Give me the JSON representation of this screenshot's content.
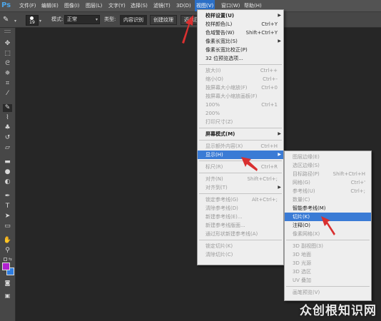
{
  "app": {
    "logo": "Ps"
  },
  "menubar": {
    "items": [
      "文件(F)",
      "编辑(E)",
      "图像(I)",
      "图层(L)",
      "文字(Y)",
      "选择(S)",
      "滤镜(T)",
      "3D(D)",
      "视图(V)",
      "窗口(W)",
      "帮助(H)"
    ],
    "active_index": 8
  },
  "options_bar": {
    "brush_size": "19",
    "mode_label": "模式:",
    "mode_value": "正常",
    "type_label": "类型:",
    "type_buttons": [
      "内容识别",
      "创建纹理",
      "近似匹配"
    ],
    "selected_type_index": 0
  },
  "colors": {
    "foreground": "#b020d0",
    "background": "#2f7de0",
    "menu_highlight": "#3a7bd5",
    "arrow": "#d93030"
  },
  "view_menu": {
    "items": [
      {
        "label": "校样设置(U)",
        "shortcut": "",
        "submenu": true,
        "bold": true,
        "disabled": false
      },
      {
        "label": "校样颜色(L)",
        "shortcut": "Ctrl+Y",
        "disabled": false
      },
      {
        "label": "色域警告(W)",
        "shortcut": "Shift+Ctrl+Y",
        "disabled": false
      },
      {
        "label": "像素长宽比(S)",
        "shortcut": "",
        "submenu": true,
        "disabled": false
      },
      {
        "label": "像素长宽比校正(P)",
        "shortcut": "",
        "disabled": false
      },
      {
        "label": "32 位预览选项...",
        "shortcut": "",
        "disabled": false,
        "sep_after": true
      },
      {
        "label": "放大(I)",
        "shortcut": "Ctrl++",
        "disabled": true
      },
      {
        "label": "缩小(O)",
        "shortcut": "Ctrl+-",
        "disabled": true
      },
      {
        "label": "按屏幕大小缩放(F)",
        "shortcut": "Ctrl+0",
        "disabled": true
      },
      {
        "label": "按屏幕大小缩放画板(F)",
        "shortcut": "",
        "disabled": true
      },
      {
        "label": "100%",
        "shortcut": "Ctrl+1",
        "disabled": true
      },
      {
        "label": "200%",
        "shortcut": "",
        "disabled": true
      },
      {
        "label": "打印尺寸(Z)",
        "shortcut": "",
        "disabled": true,
        "sep_after": true
      },
      {
        "label": "屏幕模式(M)",
        "shortcut": "",
        "submenu": true,
        "bold": true,
        "disabled": false,
        "sep_after": true
      },
      {
        "label": "显示额外内容(X)",
        "shortcut": "Ctrl+H",
        "disabled": true
      },
      {
        "label": "显示(H)",
        "shortcut": "",
        "submenu": true,
        "disabled": false,
        "highlight": true,
        "sep_after": true
      },
      {
        "label": "标尺(R)",
        "shortcut": "Ctrl+R",
        "disabled": true,
        "sep_after": true
      },
      {
        "label": "对齐(N)",
        "shortcut": "Shift+Ctrl+;",
        "disabled": true
      },
      {
        "label": "对齐到(T)",
        "shortcut": "",
        "submenu": true,
        "disabled": true,
        "sep_after": true
      },
      {
        "label": "锁定参考线(G)",
        "shortcut": "Alt+Ctrl+;",
        "disabled": true
      },
      {
        "label": "清除参考线(D)",
        "shortcut": "",
        "disabled": true
      },
      {
        "label": "新建参考线(E)...",
        "shortcut": "",
        "disabled": true
      },
      {
        "label": "新建参考线版面...",
        "shortcut": "",
        "disabled": true
      },
      {
        "label": "通过形状新建参考线(A)",
        "shortcut": "",
        "disabled": true,
        "sep_after": true
      },
      {
        "label": "锁定切片(K)",
        "shortcut": "",
        "disabled": true
      },
      {
        "label": "清除切片(C)",
        "shortcut": "",
        "disabled": true
      }
    ]
  },
  "show_submenu": {
    "items": [
      {
        "label": "图层边缘(E)",
        "shortcut": "",
        "disabled": true
      },
      {
        "label": "选区边缘(S)",
        "shortcut": "",
        "disabled": true
      },
      {
        "label": "目标路径(P)",
        "shortcut": "Shift+Ctrl+H",
        "disabled": true
      },
      {
        "label": "网格(G)",
        "shortcut": "Ctrl+'",
        "disabled": true
      },
      {
        "label": "参考线(U)",
        "shortcut": "Ctrl+;",
        "disabled": true
      },
      {
        "label": "数量(C)",
        "shortcut": "",
        "disabled": true
      },
      {
        "label": "智能参考线(M)",
        "shortcut": "",
        "disabled": false
      },
      {
        "label": "切片(K)",
        "shortcut": "",
        "disabled": false,
        "highlight": true
      },
      {
        "label": "注释(O)",
        "shortcut": "",
        "disabled": false
      },
      {
        "label": "像素网格(X)",
        "shortcut": "",
        "disabled": true,
        "sep_after": true
      },
      {
        "label": "3D 副视图(3)",
        "shortcut": "",
        "disabled": true
      },
      {
        "label": "3D 地面",
        "shortcut": "",
        "disabled": true
      },
      {
        "label": "3D 光源",
        "shortcut": "",
        "disabled": true
      },
      {
        "label": "3D 选区",
        "shortcut": "",
        "disabled": true
      },
      {
        "label": "UV 叠加",
        "shortcut": "",
        "disabled": true,
        "sep_after": true
      },
      {
        "label": "画笔预览(V)",
        "shortcut": "",
        "disabled": true
      }
    ]
  },
  "watermark": {
    "text": "众创根知识网"
  }
}
